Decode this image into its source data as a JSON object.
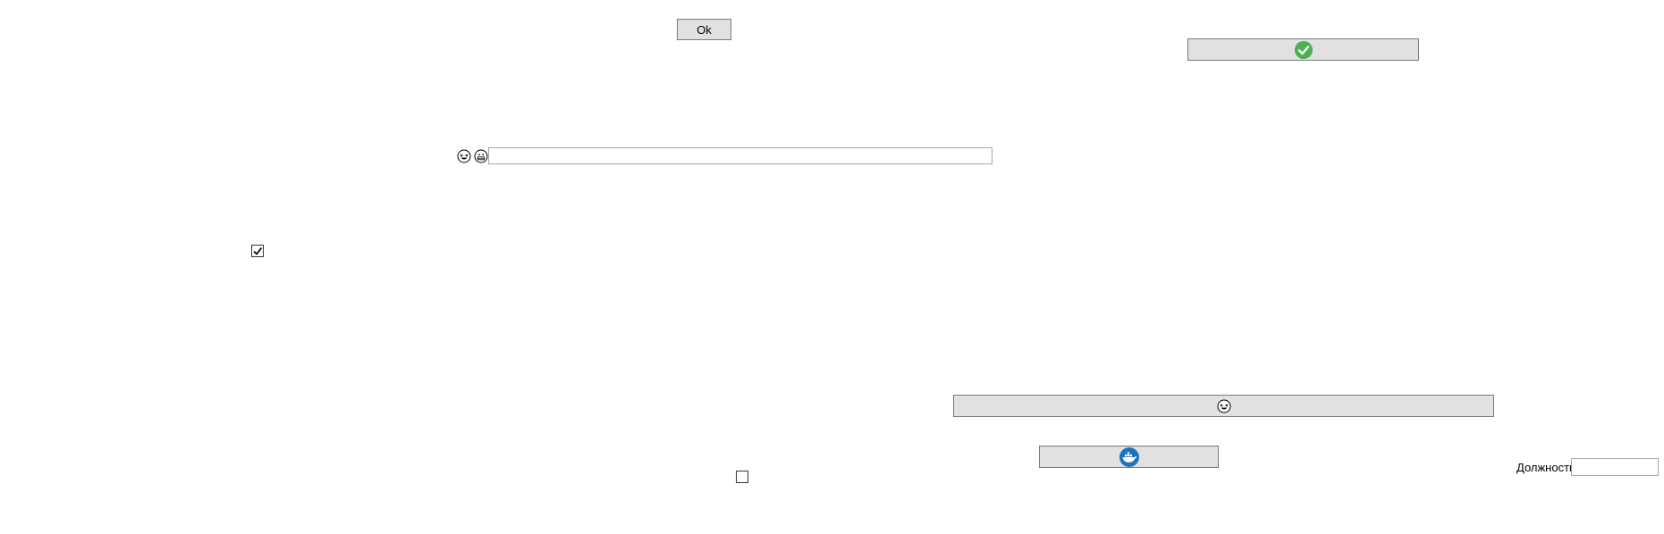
{
  "ok_button": {
    "label": "Ok"
  },
  "approve_button": {
    "icon": "checkmark-circle-icon",
    "icon_color": "#4caf50"
  },
  "emoji_button": {
    "icon": "laughing-face-icon"
  },
  "docker_button": {
    "icon": "docker-whale-icon",
    "icon_color": "#1e73be"
  },
  "emoji_row": {
    "icons": [
      "laughing-face-icon",
      "grinning-face-icon"
    ],
    "input_value": ""
  },
  "checkbox_checked": {
    "checked": true
  },
  "checkbox_unchecked": {
    "checked": false
  },
  "position_field": {
    "label": "Должность",
    "value": ""
  }
}
